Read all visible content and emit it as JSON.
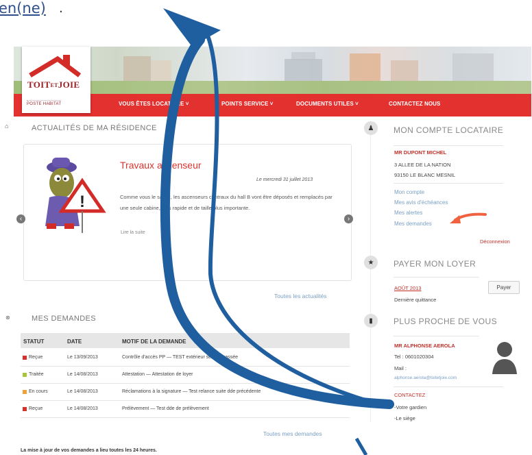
{
  "fragment_text": "en(ne)",
  "fragment_punct": ".",
  "logo": {
    "name": "TOIT ET JOIE",
    "name_main": "TOIT",
    "name_et": "ET",
    "name_joie": "JOIE",
    "tagline": "POSTE HABITAT"
  },
  "nav": {
    "items": [
      {
        "label": "VOUS ÊTES LOCATAIRE ˅"
      },
      {
        "label": "POINTS SERVICE ˅"
      },
      {
        "label": "DOCUMENTS UTILES ˅"
      },
      {
        "label": "CONTACTEZ NOUS"
      }
    ]
  },
  "news": {
    "section_title": "ACTUALITÉS DE MA RÉSIDENCE",
    "article_title": "Travaux ascenseur",
    "article_date": "Le mercredi 31 juillet 2013",
    "article_body": "Comme vous le savez, les ascenseurs centraux du hall B vont être déposés et remplacés par une seule cabine, plus rapide et de taille plus importante.",
    "read_more": "Lire la suite",
    "all_news_link": "Toutes les actualités"
  },
  "requests": {
    "section_title": "MES DEMANDES",
    "columns": [
      "STATUT",
      "DATE",
      "MOTIF DE LA DEMANDE"
    ],
    "rows": [
      {
        "status": "Reçue",
        "status_color": "#d9302b",
        "date": "Le 13/09/2013",
        "motif": "Contrôle d'accès PP — TEST extérieur serrure cassée"
      },
      {
        "status": "Traitée",
        "status_color": "#a8c43a",
        "date": "Le 14/08/2013",
        "motif": "Attestation — Attestation de loyer"
      },
      {
        "status": "En cours",
        "status_color": "#f0a23a",
        "date": "Le 14/08/2013",
        "motif": "Réclamations à la signature — Test relance suite dde précédente"
      },
      {
        "status": "Reçue",
        "status_color": "#d9302b",
        "date": "Le 14/08/2013",
        "motif": "Prélèvement — Test dde de prélèvement"
      }
    ],
    "all_link": "Toutes mes demandes",
    "update_note": "La mise à jour de vos demandes a lieu toutes les 24 heures."
  },
  "account": {
    "section_title": "MON COMPTE LOCATAIRE",
    "holder_name": "MR DUPONT MICHEL",
    "address_line1": "3 ALLEE DE LA NATION",
    "address_line2": "93150 LE BLANC MESNIL",
    "links": [
      "Mon compte",
      "Mes avis d'échéances",
      "Mes alertes",
      "Mes demandes"
    ],
    "logout": "Déconnexion"
  },
  "rent": {
    "section_title": "PAYER MON LOYER",
    "month": "AOÛT 2013",
    "pay_label": "Payer",
    "last_receipt": "Dernière quittance"
  },
  "nearest": {
    "section_title": "PLUS PROCHE DE VOUS",
    "contact_name": "MR ALPHONSE AEROLA",
    "tel": "Tel : 0601020304",
    "mail_label": "Mail :",
    "email": "alphonse.aerola@toitetjoie.com",
    "contact_heading": "CONTACTEZ",
    "contact_options": [
      "-Votre gardien",
      "-Le siège"
    ]
  },
  "colors": {
    "brand_red": "#e2312f",
    "annotation_blue": "#1f5fa0",
    "callout_orange": "#f0623f"
  }
}
